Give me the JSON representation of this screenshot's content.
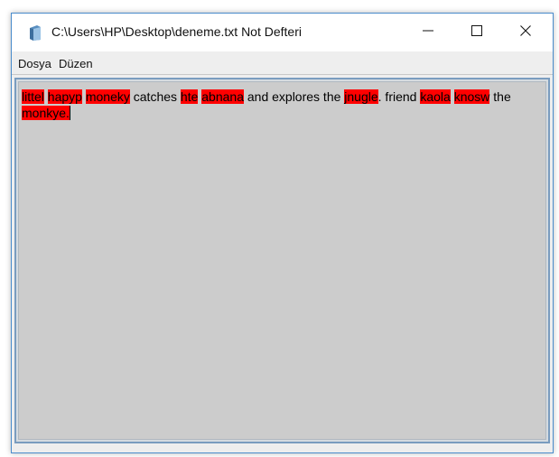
{
  "window": {
    "title": "C:\\Users\\HP\\Desktop\\deneme.txt Not Defteri",
    "app_icon": "notepad-icon",
    "controls": {
      "minimize_icon": "minimize-icon",
      "maximize_icon": "maximize-icon",
      "close_icon": "close-icon"
    }
  },
  "menu": {
    "items": [
      "Dosya",
      "Düzen"
    ]
  },
  "editor": {
    "segments": [
      {
        "text": "littel",
        "misspelled": true
      },
      {
        "text": " ",
        "misspelled": false
      },
      {
        "text": "hapyp",
        "misspelled": true
      },
      {
        "text": " ",
        "misspelled": false
      },
      {
        "text": "moneky",
        "misspelled": true
      },
      {
        "text": " catches ",
        "misspelled": false
      },
      {
        "text": "hte",
        "misspelled": true
      },
      {
        "text": " ",
        "misspelled": false
      },
      {
        "text": "abnana",
        "misspelled": true
      },
      {
        "text": " and explores the ",
        "misspelled": false
      },
      {
        "text": "jnugle",
        "misspelled": true
      },
      {
        "text": ". friend ",
        "misspelled": false
      },
      {
        "text": "kaola",
        "misspelled": true
      },
      {
        "text": " ",
        "misspelled": false
      },
      {
        "text": "knosw",
        "misspelled": true
      },
      {
        "text": " the ",
        "misspelled": false
      },
      {
        "text": "monkye.",
        "misspelled": true
      }
    ]
  },
  "colors": {
    "highlight": "#ff0000",
    "editor_background": "#cccccc",
    "window_border": "#4a8ccc"
  }
}
